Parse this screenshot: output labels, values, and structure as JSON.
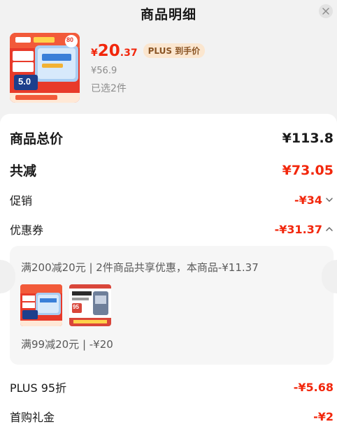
{
  "header": {
    "title": "商品明细",
    "close_icon": "close-icon"
  },
  "product": {
    "price_currency": "¥",
    "price_int": "20",
    "price_dec": ".37",
    "plus_tag": "PLUS 到手价",
    "original_price": "¥56.9",
    "selected": "已选2件",
    "thumb_badge": "5.0",
    "thumb_corner": "80"
  },
  "summary": {
    "total_label": "商品总价",
    "total_value": "¥113.8",
    "discount_label": "共减",
    "discount_value": "¥73.05",
    "promo_label": "促销",
    "promo_value": "-¥34",
    "coupon_label": "优惠券",
    "coupon_value": "-¥31.37",
    "plus_label": "PLUS 95折",
    "plus_value": "-¥5.68",
    "first_label": "首购礼金",
    "first_value": "-¥2"
  },
  "coupon_detail": {
    "line1": "满200减20元 | 2件商品共享优惠，本商品-¥11.37",
    "line2": "满99减20元 | -¥20",
    "items": [
      "wipes-product",
      "pet-food-product"
    ],
    "pet_text": "95"
  },
  "colors": {
    "accent": "#f2270c",
    "plus_bg": "#fbe6cf",
    "plus_text": "#8a5525"
  }
}
